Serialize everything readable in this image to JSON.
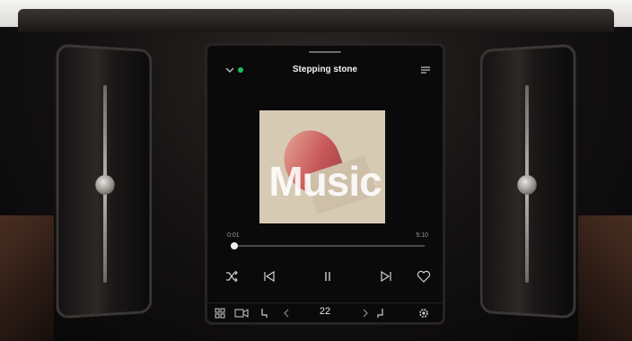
{
  "status_bar": {
    "left": "",
    "right": ""
  },
  "now_playing": {
    "title": "Stepping stone",
    "artist": "",
    "album": "",
    "overlay_word": "Music",
    "elapsed": "0:01",
    "duration": "5:10",
    "progress": 0.02
  },
  "controls": [
    "shuffle-icon",
    "previous-track-icon",
    "pause-icon",
    "next-track-icon",
    "heart-icon"
  ],
  "climate": {
    "temperature": "22",
    "unit": ""
  },
  "icons": {
    "header_left": "chevron-down-icon",
    "header_right": "queue-icon",
    "climate_left": [
      "grid-icon",
      "camera-icon",
      "seat-heat-icon"
    ],
    "climate_right": [
      "seat-heat-icon",
      "settings-icon"
    ]
  },
  "colors": {
    "accent": "#20c060",
    "screen_bg": "#0a0a0a",
    "album_bg": "#d7cab5"
  }
}
